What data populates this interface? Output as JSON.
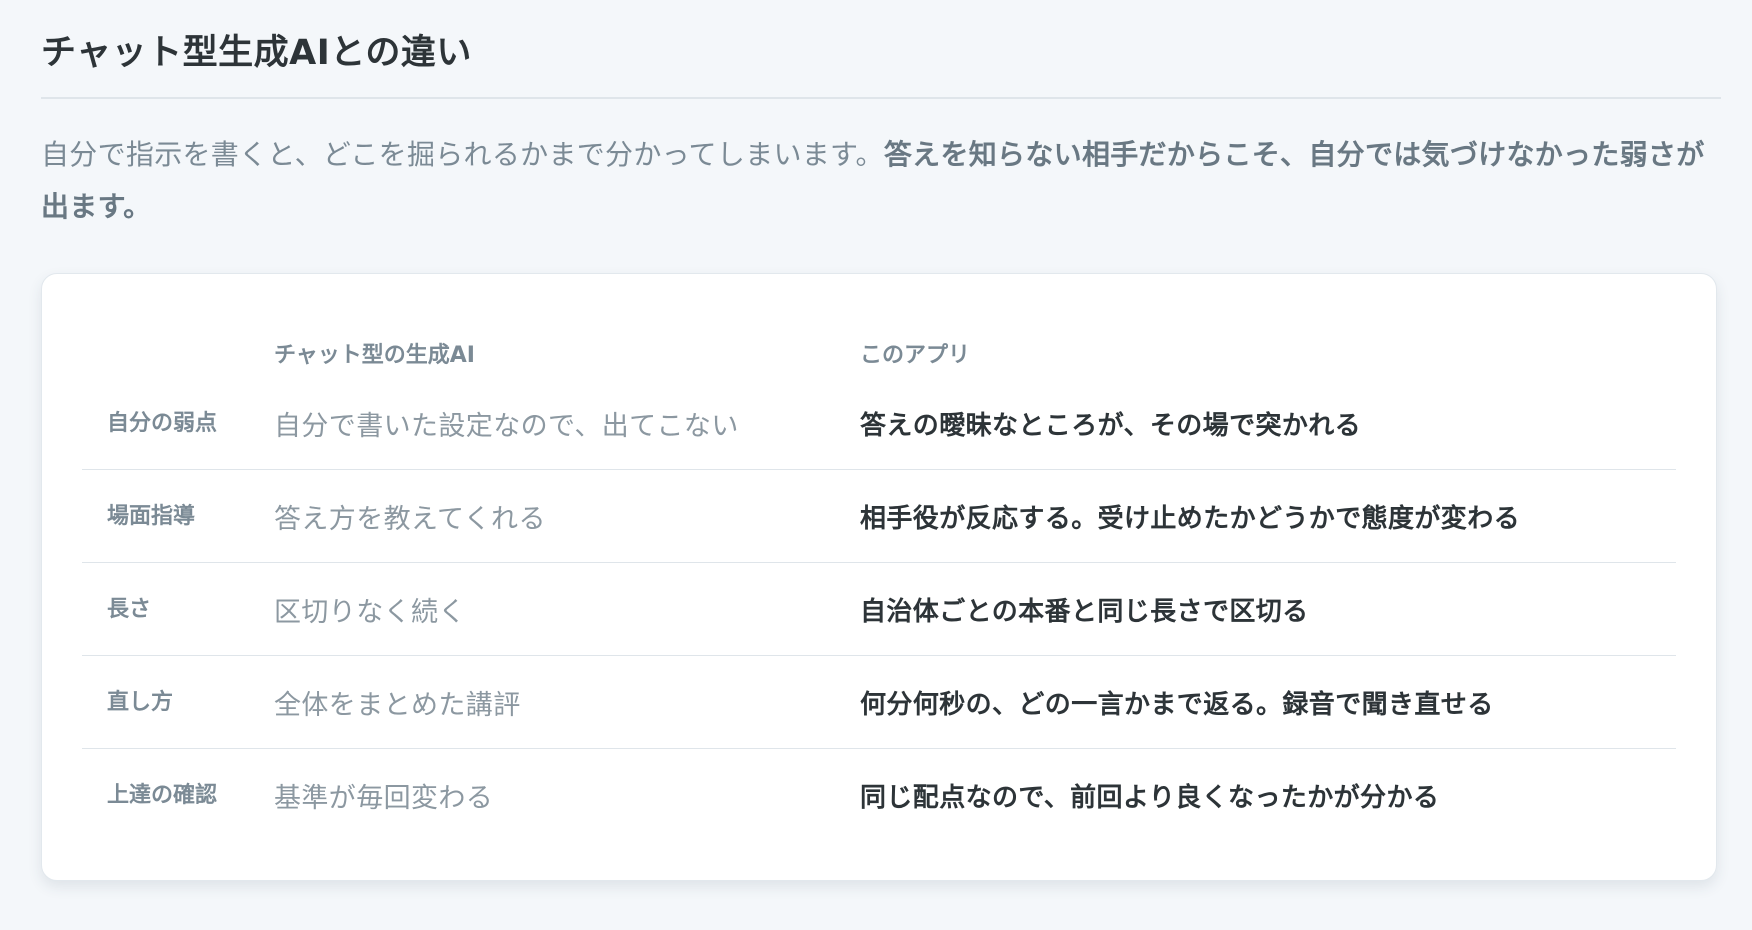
{
  "section": {
    "title": "チャット型生成AIとの違い",
    "lead_plain": "自分で指示を書くと、どこを掘られるかまで分かってしまいます。",
    "lead_bold": "答えを知らない相手だからこそ、自分では気づけなかった弱さが出ます。"
  },
  "table": {
    "headers": {
      "label": "",
      "chat": "チャット型の生成AI",
      "app": "このアプリ"
    },
    "rows": [
      {
        "label": "自分の弱点",
        "chat": "自分で書いた設定なので、出てこない",
        "app": "答えの曖昧なところが、その場で突かれる"
      },
      {
        "label": "場面指導",
        "chat": "答え方を教えてくれる",
        "app": "相手役が反応する。受け止めたかどうかで態度が変わる"
      },
      {
        "label": "長さ",
        "chat": "区切りなく続く",
        "app": "自治体ごとの本番と同じ長さで区切る"
      },
      {
        "label": "直し方",
        "chat": "全体をまとめた講評",
        "app": "何分何秒の、どの一言かまで返る。録音で聞き直せる"
      },
      {
        "label": "上達の確認",
        "chat": "基準が毎回変わる",
        "app": "同じ配点なので、前回より良くなったかが分かる"
      }
    ]
  }
}
